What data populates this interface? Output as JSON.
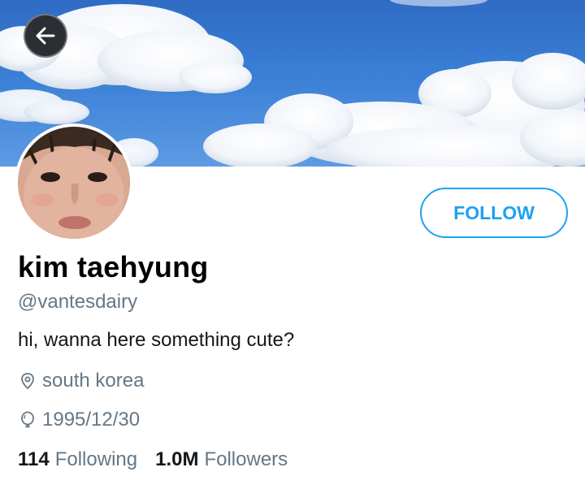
{
  "header": {
    "back_icon": "arrow-left-icon"
  },
  "profile": {
    "name": "kim taehyung",
    "handle": "@vantesdairy",
    "bio": "hi, wanna here something cute?",
    "location": "south korea",
    "location_icon": "location-pin-icon",
    "birthday": "1995/12/30",
    "birthday_icon": "balloon-icon"
  },
  "actions": {
    "follow_label": "FOLLOW"
  },
  "stats": {
    "following_count": "114",
    "following_label": "Following",
    "followers_count": "1.0M",
    "followers_label": "Followers"
  },
  "colors": {
    "accent": "#1da1f2",
    "secondary_text": "#657786",
    "sky": "#3a7fd6"
  }
}
